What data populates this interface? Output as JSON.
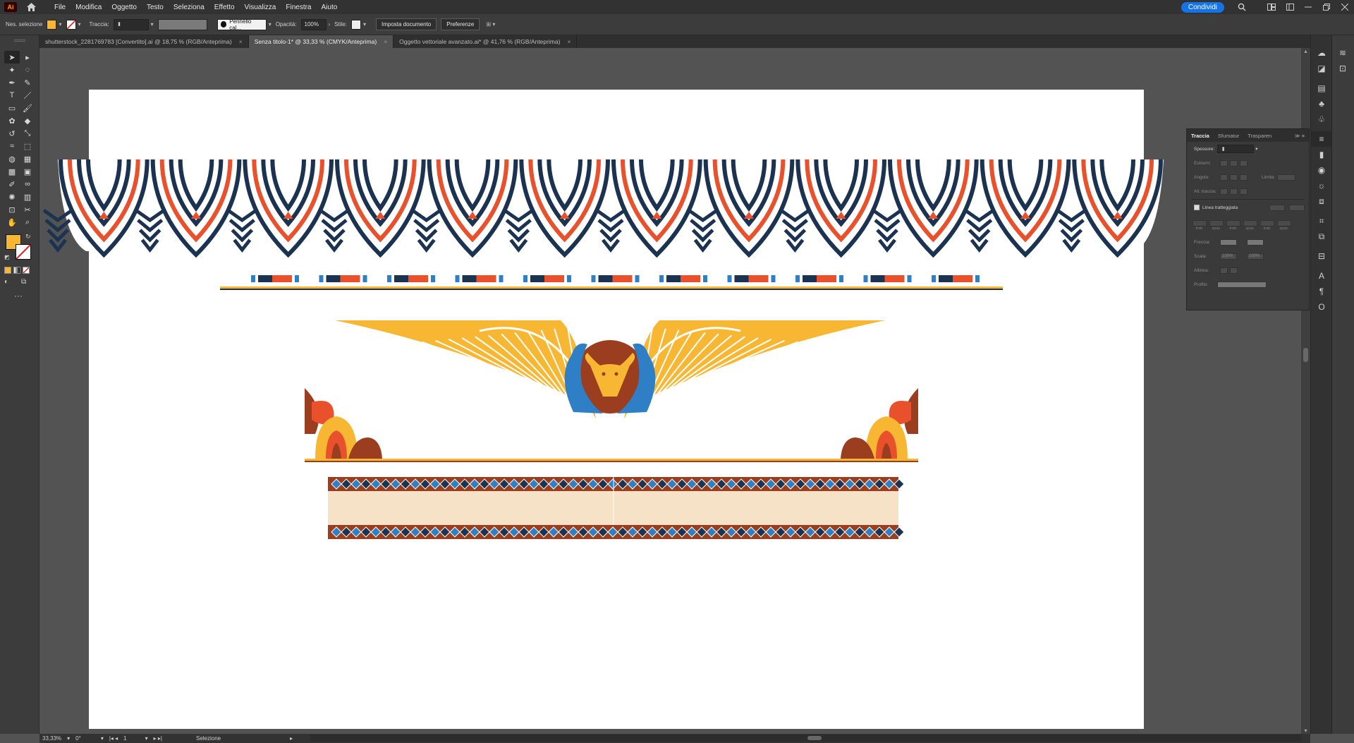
{
  "menubar": {
    "app_logo": "Ai",
    "items": [
      "File",
      "Modifica",
      "Oggetto",
      "Testo",
      "Seleziona",
      "Effetto",
      "Visualizza",
      "Finestra",
      "Aiuto"
    ],
    "share_label": "Condividi"
  },
  "controlbar": {
    "selection_label": "Nes. selezione",
    "fill_color": "#f7b733",
    "stroke_label": "Traccia:",
    "brush_label": "Pennello cal...",
    "opacity_label": "Opacità:",
    "opacity_value": "100%",
    "style_label": "Stile:",
    "doc_setup_label": "Imposta documento",
    "preferences_label": "Preferenze"
  },
  "tabs": [
    {
      "label": "shutterstock_2281769783 [Convertito].ai @ 18,75 % (RGB/Anteprima)",
      "active": false
    },
    {
      "label": "Senza titolo-1* @ 33,33 % (CMYK/Anteprima)",
      "active": true
    },
    {
      "label": "Oggetto vettoriale avanzato.ai* @ 41,76 % (RGB/Anteprima)",
      "active": false
    }
  ],
  "tab_close": "×",
  "toolbar": {
    "tools": [
      {
        "name": "selection-tool-icon",
        "glyph": "➤"
      },
      {
        "name": "direct-selection-tool-icon",
        "glyph": "▸"
      },
      {
        "name": "magic-wand-tool-icon",
        "glyph": "✦"
      },
      {
        "name": "lasso-tool-icon",
        "glyph": "◌"
      },
      {
        "name": "pen-tool-icon",
        "glyph": "✒"
      },
      {
        "name": "curvature-tool-icon",
        "glyph": "✎"
      },
      {
        "name": "type-tool-icon",
        "glyph": "T"
      },
      {
        "name": "line-tool-icon",
        "glyph": "／"
      },
      {
        "name": "rectangle-tool-icon",
        "glyph": "▭"
      },
      {
        "name": "paintbrush-tool-icon",
        "glyph": "🖌"
      },
      {
        "name": "shaper-tool-icon",
        "glyph": "✿"
      },
      {
        "name": "eraser-tool-icon",
        "glyph": "◆"
      },
      {
        "name": "rotate-tool-icon",
        "glyph": "↺"
      },
      {
        "name": "scale-tool-icon",
        "glyph": "⤡"
      },
      {
        "name": "warp-tool-icon",
        "glyph": "≈"
      },
      {
        "name": "free-transform-tool-icon",
        "glyph": "⬚"
      },
      {
        "name": "shape-builder-tool-icon",
        "glyph": "◍"
      },
      {
        "name": "perspective-grid-tool-icon",
        "glyph": "▦"
      },
      {
        "name": "mesh-tool-icon",
        "glyph": "▩"
      },
      {
        "name": "gradient-tool-icon",
        "glyph": "▣"
      },
      {
        "name": "eyedropper-tool-icon",
        "glyph": "✐"
      },
      {
        "name": "blend-tool-icon",
        "glyph": "∞"
      },
      {
        "name": "symbol-sprayer-tool-icon",
        "glyph": "✺"
      },
      {
        "name": "column-graph-tool-icon",
        "glyph": "▥"
      },
      {
        "name": "artboard-tool-icon",
        "glyph": "⊡"
      },
      {
        "name": "slice-tool-icon",
        "glyph": "✂"
      },
      {
        "name": "hand-tool-icon",
        "glyph": "✋"
      },
      {
        "name": "zoom-tool-icon",
        "glyph": "⌕"
      }
    ],
    "fill_color": "#f7b733",
    "more_label": "···"
  },
  "stroke_panel": {
    "tabs": [
      "Traccia",
      "Sfumatur",
      "Trasparen"
    ],
    "weight_label": "Spessore:",
    "rows": [
      "Estremi:",
      "Angolo:",
      "All. traccia:"
    ],
    "limit_label": "Limite:",
    "dashed_label": "Linea tratteggiata",
    "dash_cells": [
      "tratt.",
      "spaz.",
      "tratt.",
      "spaz.",
      "tratt.",
      "spaz."
    ],
    "arrow_label": "Freccia:",
    "scale_label": "Scala:",
    "scale_value": "100%",
    "align_label": "Allinea:",
    "profile_label": "Profilo:"
  },
  "statusbar": {
    "zoom": "33,33%",
    "rotation": "0°",
    "artboard": "1",
    "mode": "Selezione"
  },
  "artwork": {
    "navy": "#1b3350",
    "orange": "#e8512b",
    "gold": "#f7b733",
    "blue": "#2f7fc7",
    "brown": "#9b3e1f",
    "cream": "#f6e3c7"
  }
}
